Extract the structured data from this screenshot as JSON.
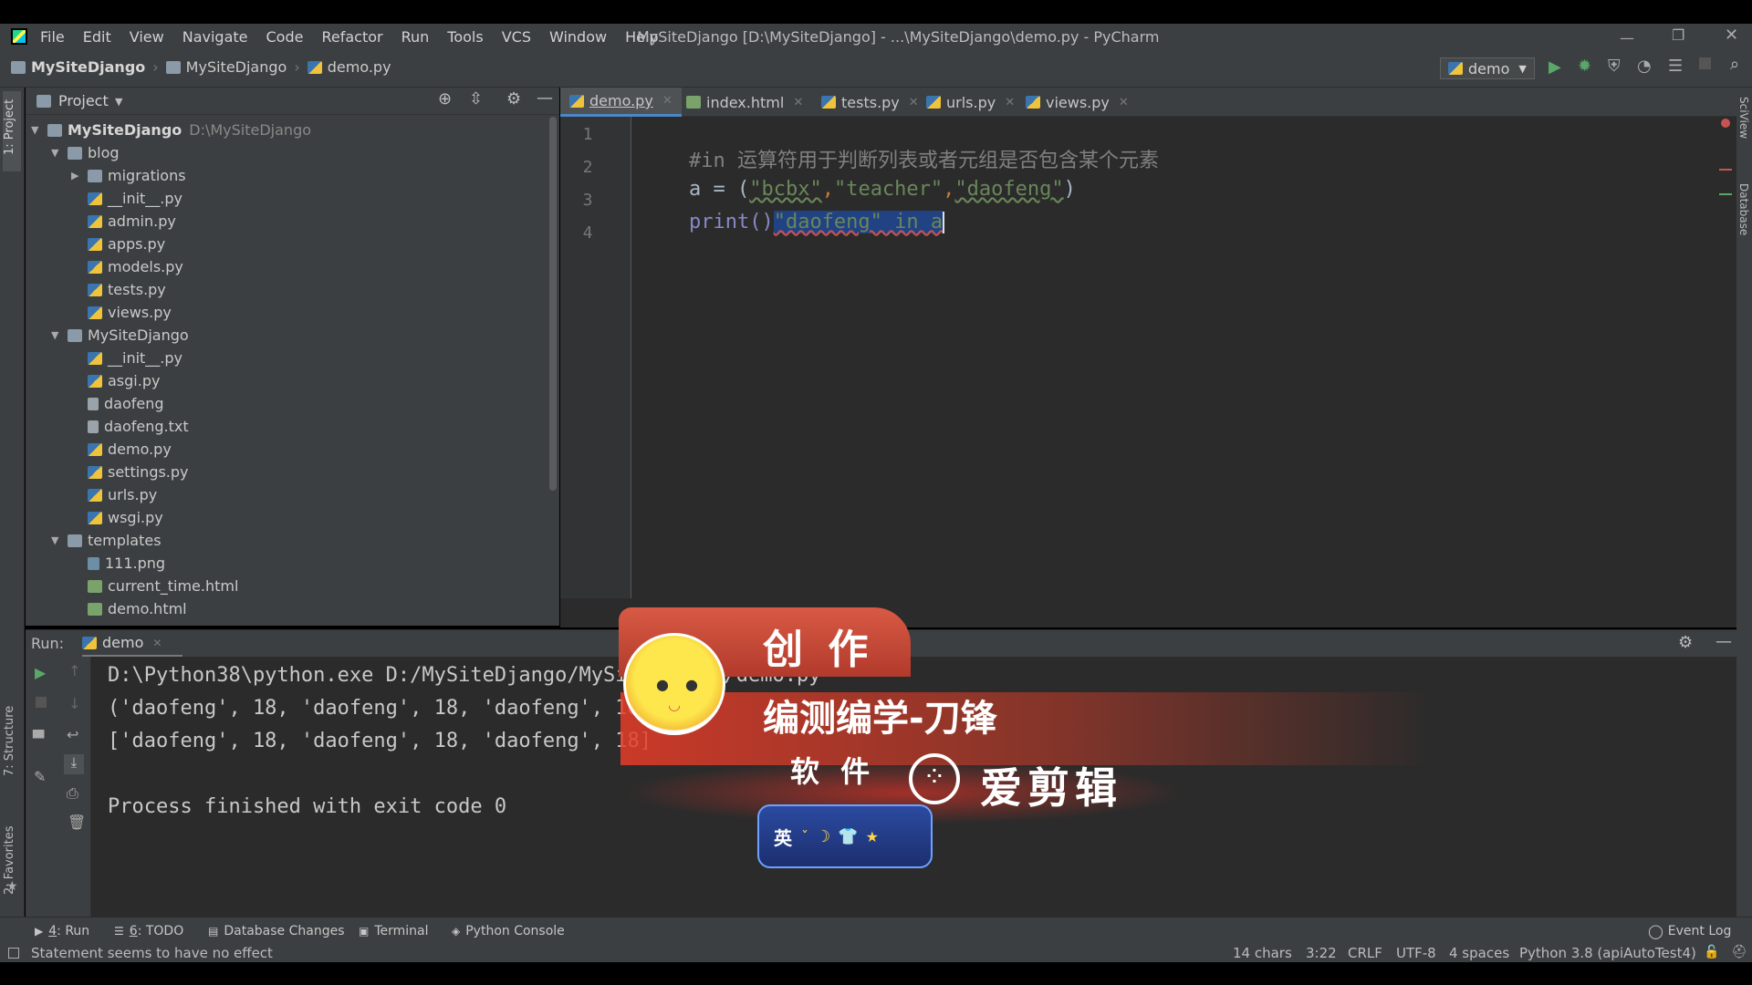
{
  "window": {
    "title": "MySiteDjango [D:\\MySiteDjango] - ...\\MySiteDjango\\demo.py - PyCharm",
    "menu": [
      "File",
      "Edit",
      "View",
      "Navigate",
      "Code",
      "Refactor",
      "Run",
      "Tools",
      "VCS",
      "Window",
      "Help"
    ]
  },
  "breadcrumb": [
    "MySiteDjango",
    "MySiteDjango",
    "demo.py"
  ],
  "run_config": "demo",
  "project_panel": {
    "title": "Project",
    "root_name": "MySiteDjango",
    "root_path": "D:\\MySiteDjango",
    "tree": [
      {
        "label": "blog",
        "type": "folder",
        "depth": 1,
        "expanded": true
      },
      {
        "label": "migrations",
        "type": "folder",
        "depth": 2,
        "expanded": false
      },
      {
        "label": "__init__.py",
        "type": "py",
        "depth": 2
      },
      {
        "label": "admin.py",
        "type": "py",
        "depth": 2
      },
      {
        "label": "apps.py",
        "type": "py",
        "depth": 2
      },
      {
        "label": "models.py",
        "type": "py",
        "depth": 2
      },
      {
        "label": "tests.py",
        "type": "py",
        "depth": 2
      },
      {
        "label": "views.py",
        "type": "py",
        "depth": 2
      },
      {
        "label": "MySiteDjango",
        "type": "folder",
        "depth": 1,
        "expanded": true
      },
      {
        "label": "__init__.py",
        "type": "py",
        "depth": 2
      },
      {
        "label": "asgi.py",
        "type": "py",
        "depth": 2
      },
      {
        "label": "daofeng",
        "type": "file",
        "depth": 2
      },
      {
        "label": "daofeng.txt",
        "type": "file",
        "depth": 2
      },
      {
        "label": "demo.py",
        "type": "py",
        "depth": 2
      },
      {
        "label": "settings.py",
        "type": "py",
        "depth": 2
      },
      {
        "label": "urls.py",
        "type": "py",
        "depth": 2
      },
      {
        "label": "wsgi.py",
        "type": "py",
        "depth": 2
      },
      {
        "label": "templates",
        "type": "folder",
        "depth": 1,
        "expanded": true
      },
      {
        "label": "111.png",
        "type": "png",
        "depth": 2
      },
      {
        "label": "current_time.html",
        "type": "html",
        "depth": 2
      },
      {
        "label": "demo.html",
        "type": "html",
        "depth": 2
      }
    ]
  },
  "editor_tabs": [
    {
      "label": "demo.py",
      "active": true,
      "icon": "python-file-icon"
    },
    {
      "label": "index.html",
      "active": false,
      "icon": "html-file-icon"
    },
    {
      "label": "tests.py",
      "active": false,
      "icon": "python-file-icon"
    },
    {
      "label": "urls.py",
      "active": false,
      "icon": "python-file-icon"
    },
    {
      "label": "views.py",
      "active": false,
      "icon": "python-file-icon"
    }
  ],
  "code": {
    "line_numbers": [
      "1",
      "2",
      "3",
      "4"
    ],
    "line1_comment": "#in 运算符用于判断列表或者元组是否包含某个元素",
    "line2": {
      "a": "a",
      "eq": " = (",
      "s1": "\"bcbx\"",
      "c1": ",",
      "s2": "\"teacher\"",
      "c2": ",",
      "s3": "\"daofeng\"",
      "close": ")"
    },
    "line3": {
      "print": "print()",
      "selected": "\"daofeng\" in a"
    }
  },
  "run_panel": {
    "label": "Run:",
    "tab": "demo",
    "output": [
      "D:\\Python38\\python.exe D:/MySiteDjango/MySiteDjango/demo.py",
      "('daofeng', 18, 'daofeng', 18, 'daofeng', 18)",
      "['daofeng', 18, 'daofeng', 18, 'daofeng', 18]",
      "",
      "Process finished with exit code 0"
    ]
  },
  "bottom_tabs": [
    {
      "num": "4",
      "label": ": Run"
    },
    {
      "num": "6",
      "label": ": TODO"
    },
    {
      "num": "",
      "label": "Database Changes"
    },
    {
      "num": "",
      "label": "Terminal"
    },
    {
      "num": "",
      "label": "Python Console"
    }
  ],
  "event_log": "Event Log",
  "side_labels": {
    "project": "1: Project",
    "structure": "7: Structure",
    "favorites": "2: Favorites",
    "sciview": "SciView",
    "database": "Database"
  },
  "status": {
    "message": "Statement seems to have no effect",
    "chars": "14 chars",
    "position": "3:22",
    "line_sep": "CRLF",
    "encoding": "UTF-8",
    "indent": "4 spaces",
    "interpreter": "Python 3.8 (apiAutoTest4)"
  },
  "overlay": {
    "create_label": "创 作",
    "author": "编测编学-刀锋",
    "software_label": "软 件",
    "software_name": "爱剪辑",
    "ime_label": "英"
  },
  "colors": {
    "accent": "#4a88c7",
    "run_green": "#59a869",
    "error_red": "#c75450",
    "string_green": "#6a8759",
    "keyword_orange": "#cc7832",
    "selection_blue": "#214283"
  }
}
